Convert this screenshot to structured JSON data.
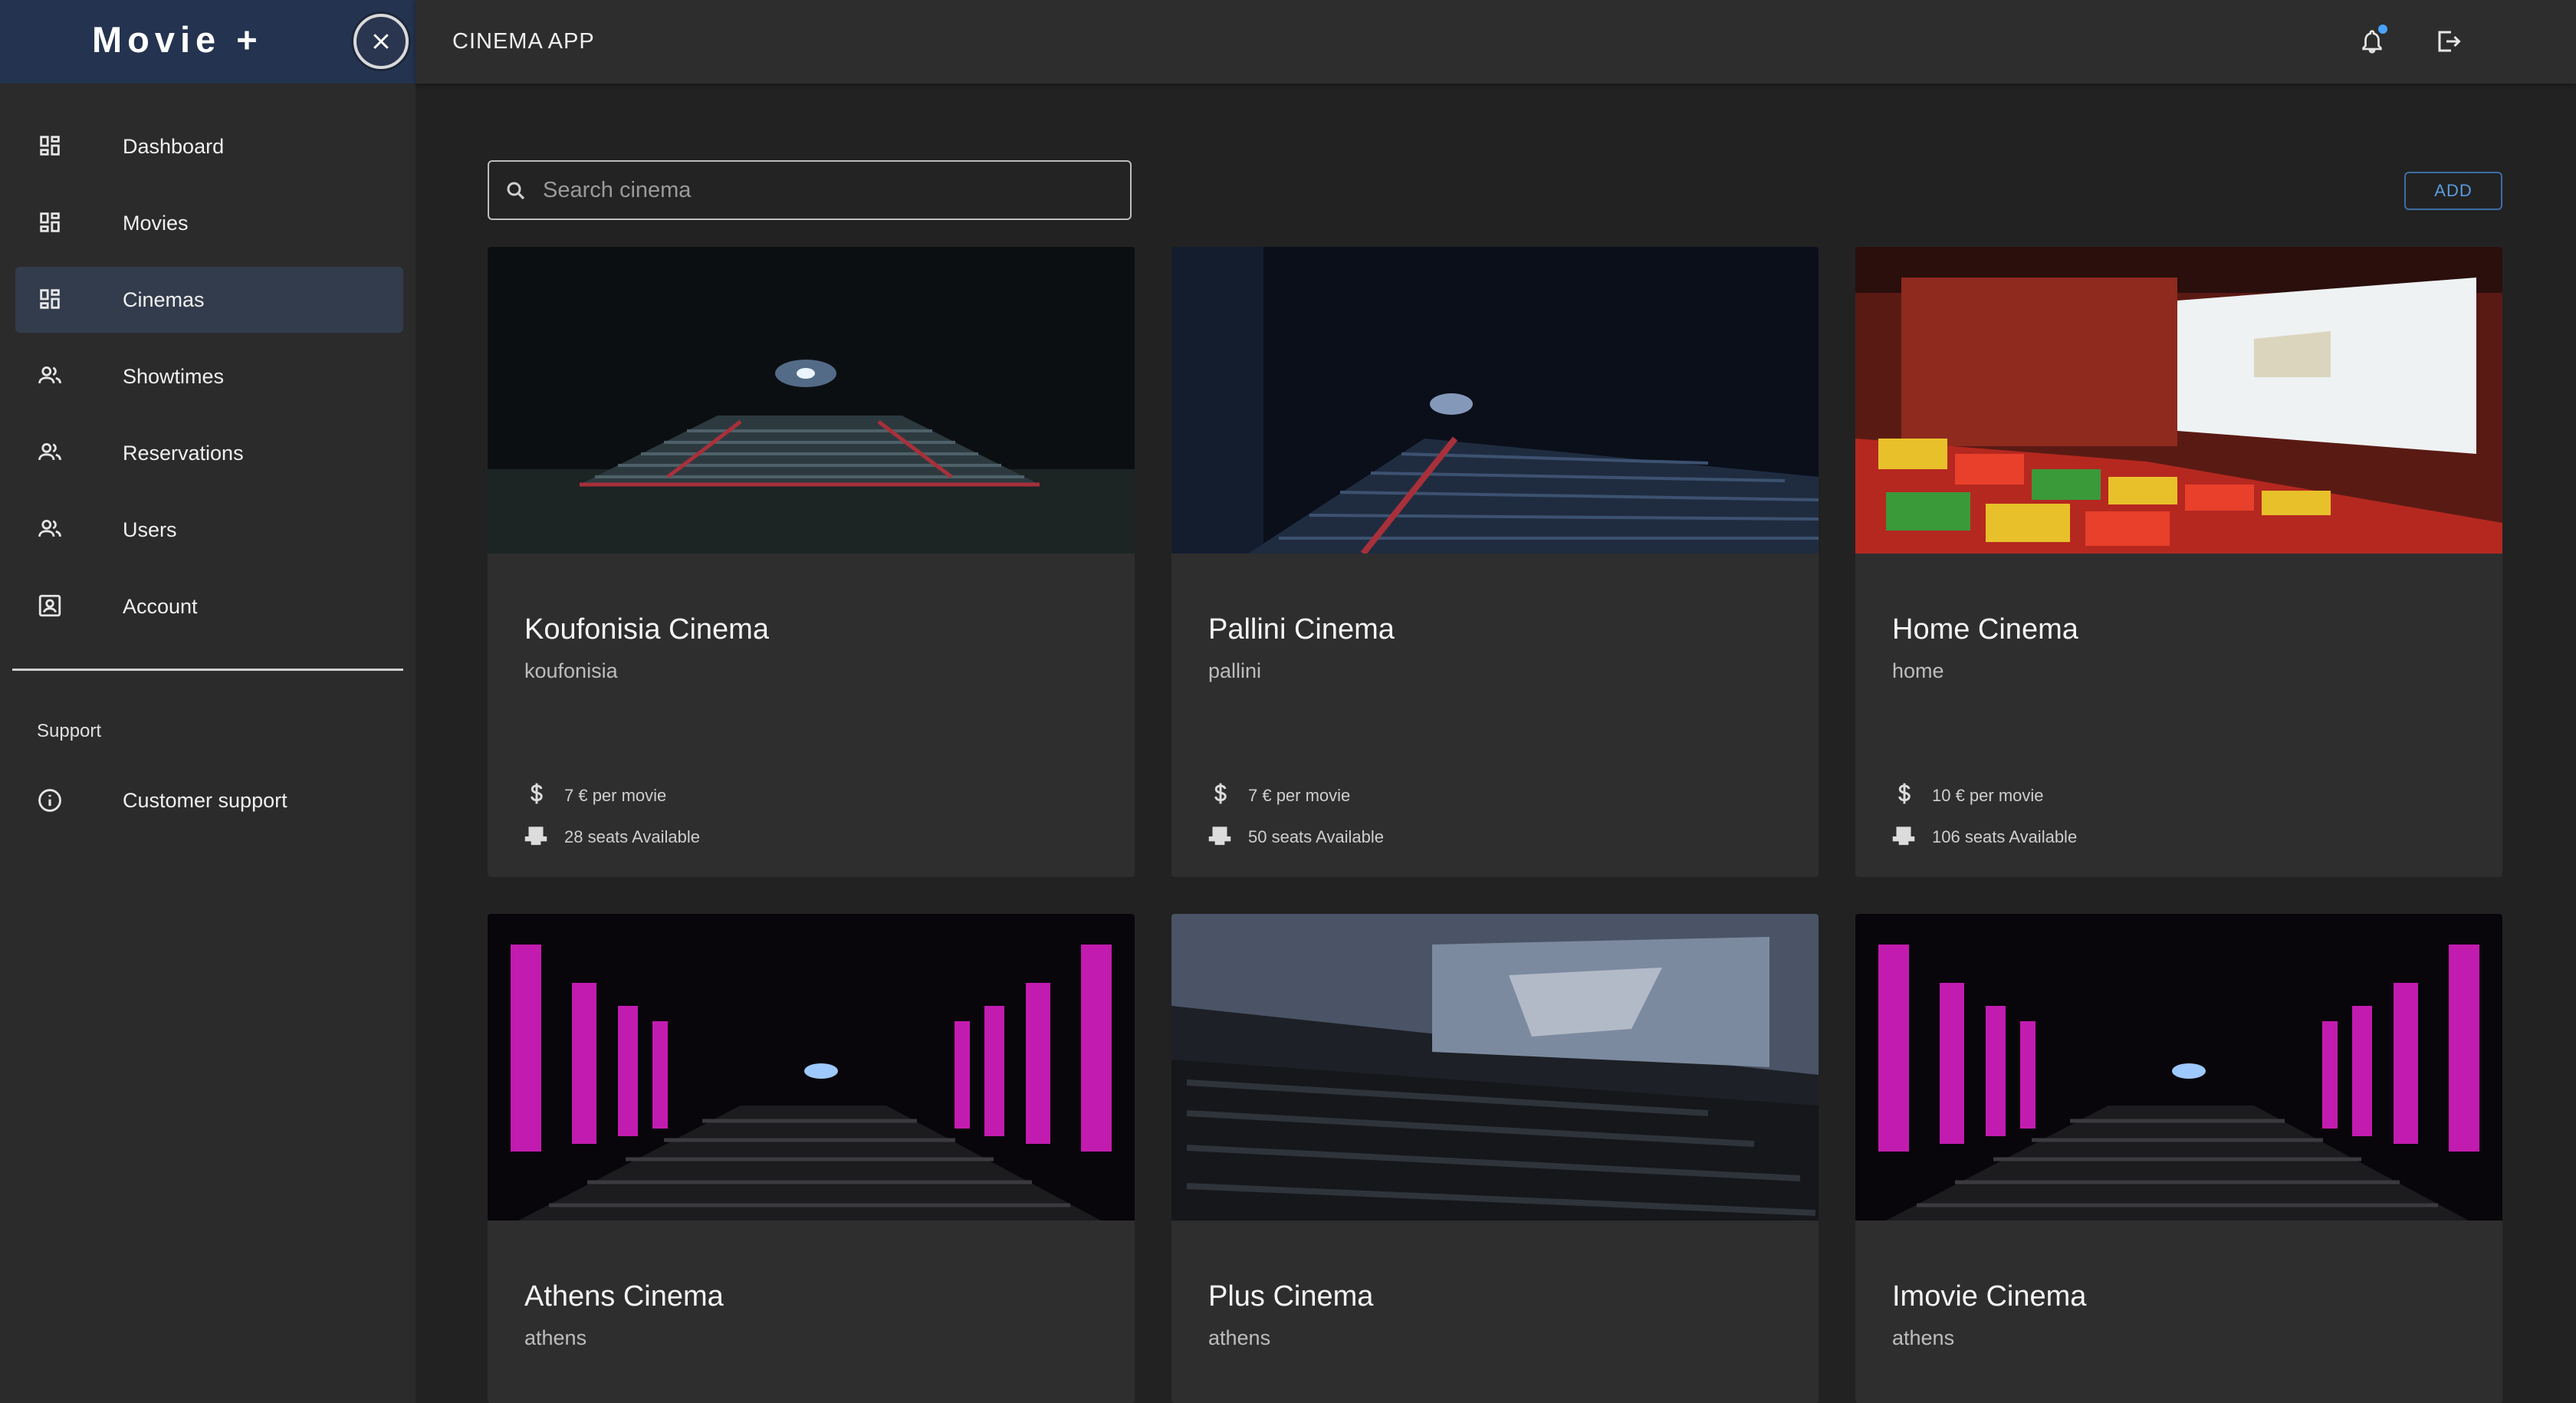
{
  "brand": {
    "title": "Movie +"
  },
  "header": {
    "title": "CINEMA APP"
  },
  "nav": {
    "items": [
      {
        "label": "Dashboard",
        "icon": "dashboard-icon"
      },
      {
        "label": "Movies",
        "icon": "dashboard-icon"
      },
      {
        "label": "Cinemas",
        "icon": "dashboard-icon",
        "active": true
      },
      {
        "label": "Showtimes",
        "icon": "people-icon"
      },
      {
        "label": "Reservations",
        "icon": "people-icon"
      },
      {
        "label": "Users",
        "icon": "people-icon"
      },
      {
        "label": "Account",
        "icon": "account-box-icon"
      }
    ],
    "support_heading": "Support",
    "support_item": {
      "label": "Customer support",
      "icon": "info-icon"
    }
  },
  "search": {
    "placeholder": "Search cinema",
    "value": ""
  },
  "toolbar": {
    "add_label": "ADD"
  },
  "cinemas": [
    {
      "name": "Koufonisia Cinema",
      "city": "koufonisia",
      "price": "7 € per movie",
      "seats": "28 seats Available"
    },
    {
      "name": "Pallini Cinema",
      "city": "pallini",
      "price": "7 € per movie",
      "seats": "50 seats Available"
    },
    {
      "name": "Home Cinema",
      "city": "home",
      "price": "10 € per movie",
      "seats": "106 seats Available"
    },
    {
      "name": "Athens Cinema",
      "city": "athens"
    },
    {
      "name": "Plus Cinema",
      "city": "athens"
    },
    {
      "name": "Imovie Cinema",
      "city": "athens"
    }
  ],
  "colors": {
    "sidebar_bg": "#2b2b2b",
    "brand_bg": "#24334f",
    "active_item_bg": "#323c4c",
    "page_bg": "#222222",
    "card_bg": "#2e2e2e",
    "accent": "#5b9be0"
  }
}
